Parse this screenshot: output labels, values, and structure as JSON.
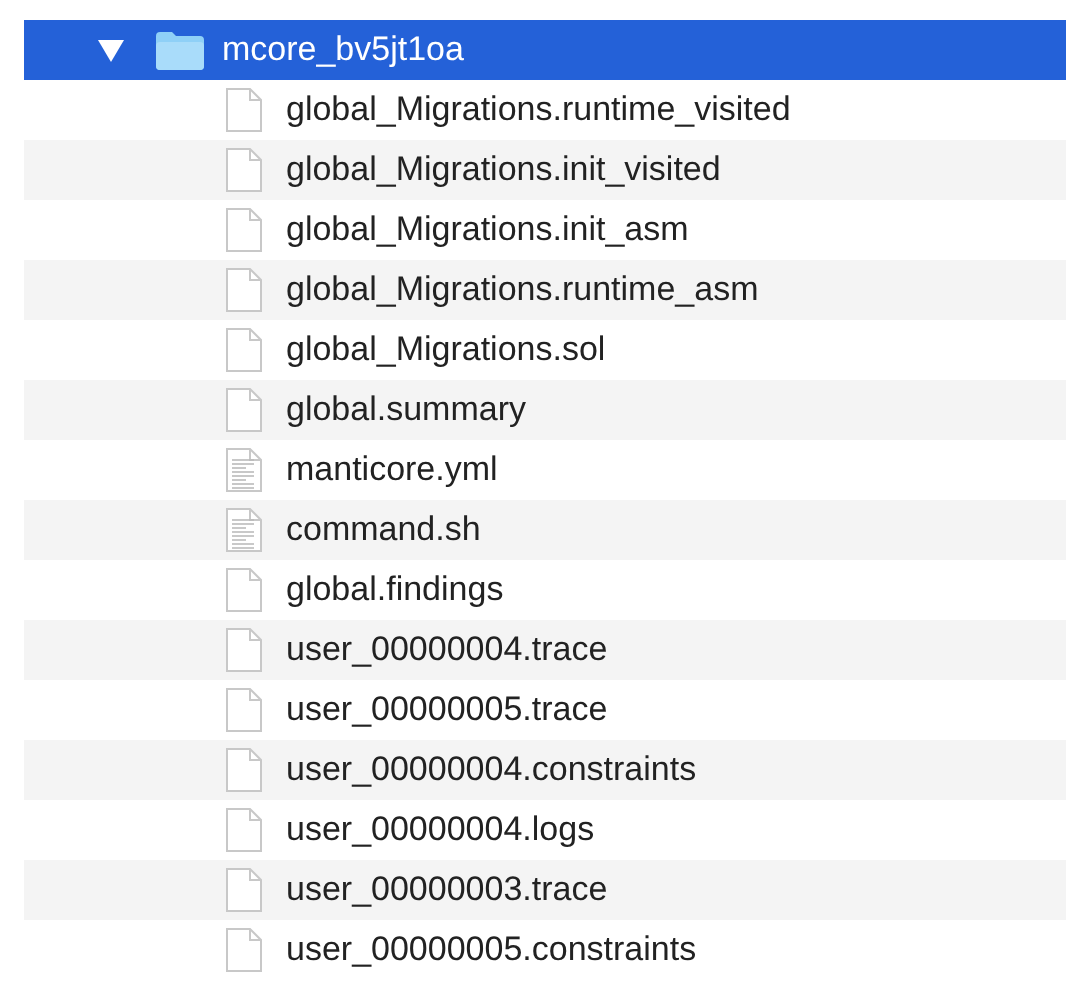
{
  "tree": {
    "name": "mcore_bv5jt1oa",
    "expanded": true,
    "selected": true,
    "children": [
      {
        "name": "global_Migrations.runtime_visited",
        "kind": "blank",
        "selected": false
      },
      {
        "name": "global_Migrations.init_visited",
        "kind": "blank",
        "selected": false
      },
      {
        "name": "global_Migrations.init_asm",
        "kind": "blank",
        "selected": false
      },
      {
        "name": "global_Migrations.runtime_asm",
        "kind": "blank",
        "selected": false
      },
      {
        "name": "global_Migrations.sol",
        "kind": "blank",
        "selected": false
      },
      {
        "name": "global.summary",
        "kind": "blank",
        "selected": false
      },
      {
        "name": "manticore.yml",
        "kind": "text",
        "selected": false
      },
      {
        "name": "command.sh",
        "kind": "text",
        "selected": false
      },
      {
        "name": "global.findings",
        "kind": "blank",
        "selected": false
      },
      {
        "name": "user_00000004.trace",
        "kind": "blank",
        "selected": false
      },
      {
        "name": "user_00000005.trace",
        "kind": "blank",
        "selected": false
      },
      {
        "name": "user_00000004.constraints",
        "kind": "blank",
        "selected": false
      },
      {
        "name": "user_00000004.logs",
        "kind": "blank",
        "selected": false
      },
      {
        "name": "user_00000003.trace",
        "kind": "blank",
        "selected": false
      },
      {
        "name": "user_00000005.constraints",
        "kind": "blank",
        "selected": false
      }
    ]
  }
}
